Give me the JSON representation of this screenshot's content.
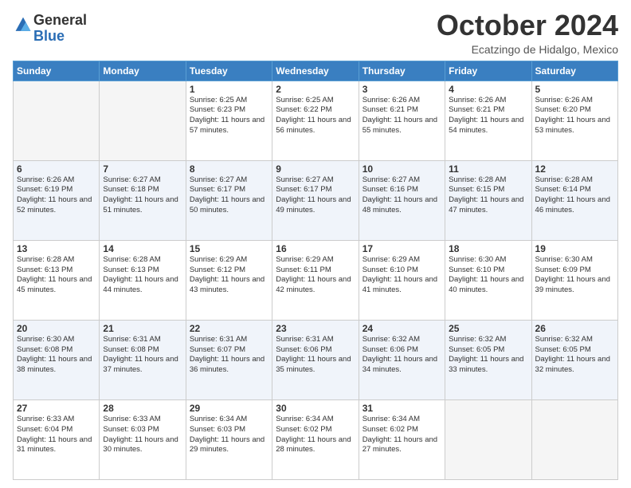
{
  "header": {
    "logo_general": "General",
    "logo_blue": "Blue",
    "month_title": "October 2024",
    "location": "Ecatzingo de Hidalgo, Mexico"
  },
  "days_of_week": [
    "Sunday",
    "Monday",
    "Tuesday",
    "Wednesday",
    "Thursday",
    "Friday",
    "Saturday"
  ],
  "weeks": [
    [
      {
        "day": "",
        "info": ""
      },
      {
        "day": "",
        "info": ""
      },
      {
        "day": "1",
        "info": "Sunrise: 6:25 AM\nSunset: 6:23 PM\nDaylight: 11 hours and 57 minutes."
      },
      {
        "day": "2",
        "info": "Sunrise: 6:25 AM\nSunset: 6:22 PM\nDaylight: 11 hours and 56 minutes."
      },
      {
        "day": "3",
        "info": "Sunrise: 6:26 AM\nSunset: 6:21 PM\nDaylight: 11 hours and 55 minutes."
      },
      {
        "day": "4",
        "info": "Sunrise: 6:26 AM\nSunset: 6:21 PM\nDaylight: 11 hours and 54 minutes."
      },
      {
        "day": "5",
        "info": "Sunrise: 6:26 AM\nSunset: 6:20 PM\nDaylight: 11 hours and 53 minutes."
      }
    ],
    [
      {
        "day": "6",
        "info": "Sunrise: 6:26 AM\nSunset: 6:19 PM\nDaylight: 11 hours and 52 minutes."
      },
      {
        "day": "7",
        "info": "Sunrise: 6:27 AM\nSunset: 6:18 PM\nDaylight: 11 hours and 51 minutes."
      },
      {
        "day": "8",
        "info": "Sunrise: 6:27 AM\nSunset: 6:17 PM\nDaylight: 11 hours and 50 minutes."
      },
      {
        "day": "9",
        "info": "Sunrise: 6:27 AM\nSunset: 6:17 PM\nDaylight: 11 hours and 49 minutes."
      },
      {
        "day": "10",
        "info": "Sunrise: 6:27 AM\nSunset: 6:16 PM\nDaylight: 11 hours and 48 minutes."
      },
      {
        "day": "11",
        "info": "Sunrise: 6:28 AM\nSunset: 6:15 PM\nDaylight: 11 hours and 47 minutes."
      },
      {
        "day": "12",
        "info": "Sunrise: 6:28 AM\nSunset: 6:14 PM\nDaylight: 11 hours and 46 minutes."
      }
    ],
    [
      {
        "day": "13",
        "info": "Sunrise: 6:28 AM\nSunset: 6:13 PM\nDaylight: 11 hours and 45 minutes."
      },
      {
        "day": "14",
        "info": "Sunrise: 6:28 AM\nSunset: 6:13 PM\nDaylight: 11 hours and 44 minutes."
      },
      {
        "day": "15",
        "info": "Sunrise: 6:29 AM\nSunset: 6:12 PM\nDaylight: 11 hours and 43 minutes."
      },
      {
        "day": "16",
        "info": "Sunrise: 6:29 AM\nSunset: 6:11 PM\nDaylight: 11 hours and 42 minutes."
      },
      {
        "day": "17",
        "info": "Sunrise: 6:29 AM\nSunset: 6:10 PM\nDaylight: 11 hours and 41 minutes."
      },
      {
        "day": "18",
        "info": "Sunrise: 6:30 AM\nSunset: 6:10 PM\nDaylight: 11 hours and 40 minutes."
      },
      {
        "day": "19",
        "info": "Sunrise: 6:30 AM\nSunset: 6:09 PM\nDaylight: 11 hours and 39 minutes."
      }
    ],
    [
      {
        "day": "20",
        "info": "Sunrise: 6:30 AM\nSunset: 6:08 PM\nDaylight: 11 hours and 38 minutes."
      },
      {
        "day": "21",
        "info": "Sunrise: 6:31 AM\nSunset: 6:08 PM\nDaylight: 11 hours and 37 minutes."
      },
      {
        "day": "22",
        "info": "Sunrise: 6:31 AM\nSunset: 6:07 PM\nDaylight: 11 hours and 36 minutes."
      },
      {
        "day": "23",
        "info": "Sunrise: 6:31 AM\nSunset: 6:06 PM\nDaylight: 11 hours and 35 minutes."
      },
      {
        "day": "24",
        "info": "Sunrise: 6:32 AM\nSunset: 6:06 PM\nDaylight: 11 hours and 34 minutes."
      },
      {
        "day": "25",
        "info": "Sunrise: 6:32 AM\nSunset: 6:05 PM\nDaylight: 11 hours and 33 minutes."
      },
      {
        "day": "26",
        "info": "Sunrise: 6:32 AM\nSunset: 6:05 PM\nDaylight: 11 hours and 32 minutes."
      }
    ],
    [
      {
        "day": "27",
        "info": "Sunrise: 6:33 AM\nSunset: 6:04 PM\nDaylight: 11 hours and 31 minutes."
      },
      {
        "day": "28",
        "info": "Sunrise: 6:33 AM\nSunset: 6:03 PM\nDaylight: 11 hours and 30 minutes."
      },
      {
        "day": "29",
        "info": "Sunrise: 6:34 AM\nSunset: 6:03 PM\nDaylight: 11 hours and 29 minutes."
      },
      {
        "day": "30",
        "info": "Sunrise: 6:34 AM\nSunset: 6:02 PM\nDaylight: 11 hours and 28 minutes."
      },
      {
        "day": "31",
        "info": "Sunrise: 6:34 AM\nSunset: 6:02 PM\nDaylight: 11 hours and 27 minutes."
      },
      {
        "day": "",
        "info": ""
      },
      {
        "day": "",
        "info": ""
      }
    ]
  ]
}
